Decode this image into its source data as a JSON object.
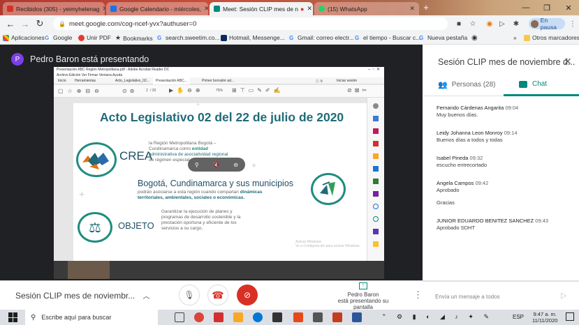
{
  "browser": {
    "tabs": [
      {
        "label": "Recibidos (305) - yeimyhelenag",
        "color": "#d93025"
      },
      {
        "label": "Google Calendario - miércoles,",
        "color": "#1a73e8"
      },
      {
        "label": "Meet: Sesión CLIP mes de n",
        "color": "#00897b"
      },
      {
        "label": "(15) WhatsApp",
        "color": "#25d366"
      }
    ],
    "url": "meet.google.com/cog-ncef-yvx?authuser=0",
    "profile_label": "En pausa",
    "bookmarks": [
      "Aplicaciones",
      "Google",
      "Unir PDF",
      "Bookmarks",
      "search.sweetim.co...",
      "Hotmail, Messenge...",
      "Gmail: correo electr...",
      "el tiempo - Buscar c...",
      "Nueva pestaña"
    ],
    "other_bookmarks": "Otros marcadores"
  },
  "meet": {
    "presenter_initial": "P",
    "presenter_banner": "Pedro Baron está presentando",
    "meeting_name": "Sesión CLIP mes de noviembr...",
    "presenting_name": "Pedro Baron",
    "presenting_sub": "está presentando su pantalla"
  },
  "pdf": {
    "title": "Presentación ABC Región Metropolitana.pdf - Adobe Acrobat Reader DC",
    "menu": "Archivo  Edición  Ver  Firmar  Ventana  Ayuda",
    "tabs": [
      "Inicio",
      "Herramientas",
      "Acto_Legislativo_02...",
      "Presentación ABC...",
      "Primer borrador ad..."
    ],
    "signin": "Iniciar sesión",
    "zoom": "75%",
    "page": "2",
    "page_total": "/ 20"
  },
  "slide": {
    "title": "Acto Legislativo 02 del 22 de julio de 2020",
    "crea_label": "CREA",
    "crea_text_1": "la Región Metropolitana Bogotá –",
    "crea_text_2": "Cundinamarca como",
    "crea_text_2b": "entidad",
    "crea_text_3": "administrativa de asociatividad regional",
    "crea_text_4": "de régimen especial",
    "muni_title": "Bogotá, Cundinamarca y sus municipios",
    "muni_text_1": "podrán asociarse a esta región cuando compartan",
    "muni_text_1b": "dinámicas",
    "muni_text_2": "territoriales, ambientales, sociales o económicas.",
    "objeto_label": "OBJETO",
    "objeto_text_1": "Garantizar la ejecución de planes y",
    "objeto_text_2": "programas de desarrollo sostenible y la",
    "objeto_text_3": "prestación oportuna y eficiente de los",
    "objeto_text_4": "servicios a su cargo.",
    "watermark_1": "Activar Windows",
    "watermark_2": "Ve a Configuración para activar Windows."
  },
  "panel": {
    "title": "Sesión CLIP mes de noviembre d...",
    "people_tab": "Personas (28)",
    "chat_tab": "Chat",
    "messages": [
      {
        "author": "Fernando Cárdenas Angarita",
        "time": "09:04",
        "lines": [
          "Muy buenos días."
        ]
      },
      {
        "author": "Leidy Johanna Leon Monroy",
        "time": "09:14",
        "lines": [
          "Buenos días a todos y todas"
        ]
      },
      {
        "author": "Isabel Pineda",
        "time": "09:32",
        "lines": [
          "escucho entrecortado"
        ]
      },
      {
        "author": "Angela Campos",
        "time": "09:42",
        "lines": [
          "Aprobado",
          "Gracias"
        ]
      },
      {
        "author": "JUNIOR EDUARDO BENITEZ SANCHEZ",
        "time": "09:43",
        "lines": [
          "Aprobado SDHT"
        ]
      }
    ],
    "input_placeholder": "Envía un mensaje a todos"
  },
  "taskbar": {
    "search_placeholder": "Escribe aquí para buscar",
    "lang": "ESP",
    "time": "9:47 a. m.",
    "date": "11/11/2020"
  },
  "colors": {
    "meet_bg": "#202124",
    "accent_green": "#00897b",
    "end_call_red": "#d93025",
    "slide_teal": "#1f8c7f"
  }
}
